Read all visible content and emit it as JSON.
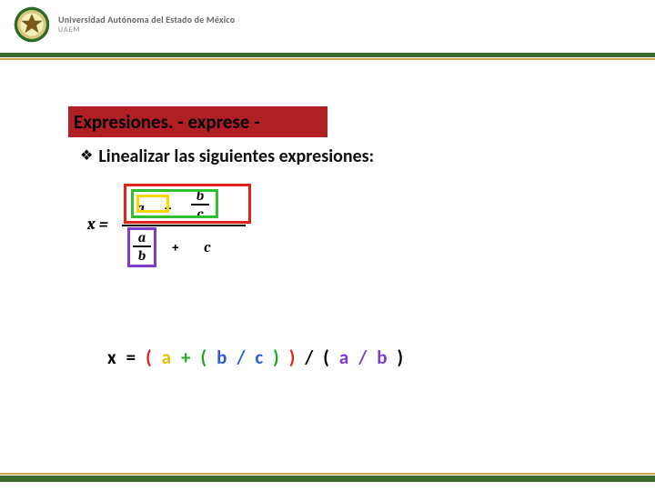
{
  "header": {
    "university": "Universidad Autónoma del Estado de México",
    "acronym": "UAEM"
  },
  "title": "Expresiones. -  exprese -",
  "bullet": {
    "glyph": "❖",
    "text": "Linealizar las siguientes expresiones:"
  },
  "formula": {
    "lhs": "x =",
    "num_a": "a",
    "num_plus": "+",
    "num_b": "b",
    "num_c": "c",
    "den_a": "a",
    "den_b": "b",
    "den_plus": "+",
    "den_c": "c"
  },
  "linear_tokens": [
    {
      "t": "x",
      "c": "c-black"
    },
    {
      "t": "=",
      "c": "c-black"
    },
    {
      "t": "(",
      "c": "c-red"
    },
    {
      "t": "a",
      "c": "c-yellow"
    },
    {
      "t": "+",
      "c": "c-green"
    },
    {
      "t": "(",
      "c": "c-green"
    },
    {
      "t": "b",
      "c": "c-blue"
    },
    {
      "t": "/",
      "c": "c-blue"
    },
    {
      "t": "c",
      "c": "c-blue"
    },
    {
      "t": ")",
      "c": "c-green"
    },
    {
      "t": ")",
      "c": "c-red"
    },
    {
      "t": "/",
      "c": "c-black"
    },
    {
      "t": "(",
      "c": "c-black"
    },
    {
      "t": "a",
      "c": "c-purple"
    },
    {
      "t": "/",
      "c": "c-purple"
    },
    {
      "t": "b",
      "c": "c-purple"
    },
    {
      "t": ")",
      "c": "c-black"
    }
  ],
  "colors": {
    "brand_green": "#3a6b2d",
    "brand_gold": "#cfa64e",
    "title_bg": "#b01f24"
  }
}
